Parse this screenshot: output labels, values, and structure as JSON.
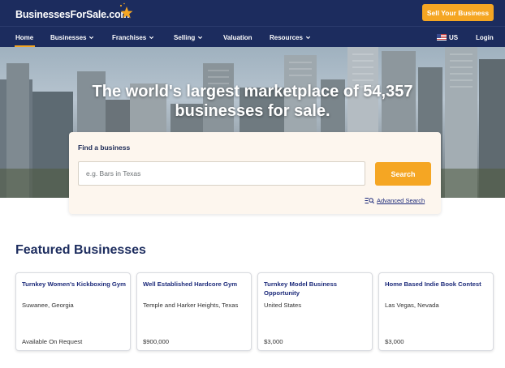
{
  "header": {
    "logo_text": "BusinessesForSale.com",
    "sell_button": "Sell Your Business"
  },
  "nav": {
    "items": [
      {
        "label": "Home",
        "dropdown": false,
        "active": true
      },
      {
        "label": "Businesses",
        "dropdown": true
      },
      {
        "label": "Franchises",
        "dropdown": true
      },
      {
        "label": "Selling",
        "dropdown": true
      },
      {
        "label": "Valuation",
        "dropdown": false
      },
      {
        "label": "Resources",
        "dropdown": true
      }
    ],
    "region": "US",
    "login": "Login"
  },
  "hero": {
    "title_line1": "The world's largest marketplace of 54,357",
    "title_line2": "businesses for sale."
  },
  "search": {
    "label": "Find a business",
    "placeholder": "e.g. Bars in Texas",
    "button": "Search",
    "advanced": "Advanced Search"
  },
  "featured": {
    "title": "Featured Businesses",
    "cards": [
      {
        "title": "Turnkey Women's Kickboxing Gym",
        "location": "Suwanee, Georgia",
        "price": "Available On Request"
      },
      {
        "title": "Well Established Hardcore Gym",
        "location": "Temple and Harker Heights, Texas",
        "price": "$900,000"
      },
      {
        "title": "Turnkey Model Business Opportunity",
        "location": "United States",
        "price": "$3,000"
      },
      {
        "title": "Home Based Indie Book Contest",
        "location": "Las Vegas, Nevada",
        "price": "$3,000"
      }
    ]
  },
  "colors": {
    "navy": "#1c2c5e",
    "accent_orange": "#f5a623",
    "link_blue": "#1c2a7a",
    "search_panel": "#fdf6ee"
  },
  "icons": {
    "logo_star": "star-icon",
    "dropdown": "chevron-down-icon",
    "region_flag": "us-flag-icon",
    "advanced_search": "filter-search-icon"
  }
}
